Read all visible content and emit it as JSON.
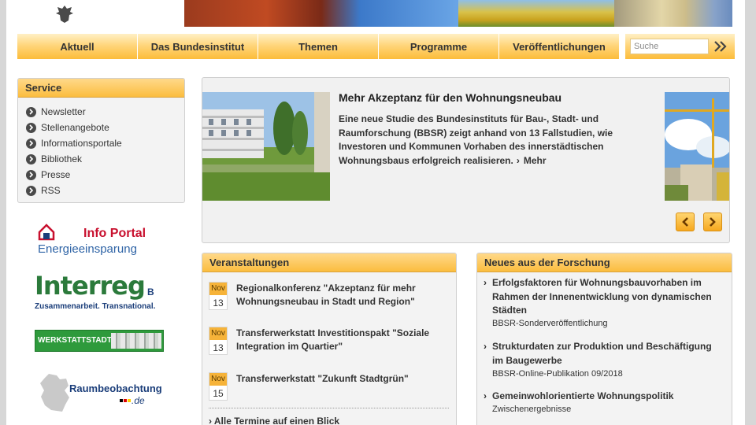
{
  "nav": {
    "items": [
      "Aktuell",
      "Das Bundesinstitut",
      "Themen",
      "Programme",
      "Veröffentlichungen"
    ],
    "search_placeholder": "Suche"
  },
  "service": {
    "title": "Service",
    "items": [
      "Newsletter",
      "Stellenangebote",
      "Informationsportale",
      "Bibliothek",
      "Presse",
      "RSS"
    ]
  },
  "logos": {
    "info_portal": {
      "line1": "Info Portal",
      "line2": "Energieeinsparung"
    },
    "interreg": {
      "name": "Interreg",
      "suffix": "B",
      "tagline": "Zusammenarbeit. Transnational."
    },
    "werkstatt": {
      "name": "WERKSTATTSTADT"
    },
    "raumbeobachtung": {
      "name": "Raumbeobachtung",
      "tld": ".de"
    }
  },
  "slider": {
    "title": "Mehr Akzeptanz für den Wohnungsneubau",
    "text": "Eine neue Studie des Bundesinstituts für Bau-, Stadt- und Raumforschung (BBSR) zeigt anhand von 13 Fallstudien, wie Investoren und Kommunen Vorhaben des innerstädtischen Wohnungsbaus erfolgreich realisieren.",
    "more": "Mehr"
  },
  "events": {
    "title": "Veranstaltungen",
    "items": [
      {
        "month": "Nov",
        "day": "13",
        "title": "Regionalkonferenz \"Akzeptanz für mehr Wohnungsneubau in Stadt und Region\""
      },
      {
        "month": "Nov",
        "day": "13",
        "title": "Transferwerkstatt Investitionspakt \"Soziale Integration im Quartier\""
      },
      {
        "month": "Nov",
        "day": "15",
        "title": "Transferwerkstatt \"Zukunft Stadtgrün\""
      }
    ],
    "all_link": "Alle Termine auf einen Blick"
  },
  "research": {
    "title": "Neues aus der Forschung",
    "items": [
      {
        "title": "Erfolgsfaktoren für Wohnungsbauvorhaben im Rahmen der Innenentwicklung von dynamischen Städten",
        "sub": "BBSR-Sonderveröffentlichung"
      },
      {
        "title": "Strukturdaten zur Produktion und Beschäftigung im Baugewerbe",
        "sub": "BBSR-Online-Publikation 09/2018"
      },
      {
        "title": "Gemeinwohlorientierte Wohnungspolitik",
        "sub": "Zwischenergebnisse"
      }
    ]
  },
  "colors": {
    "accent": "#fbbd3f",
    "accent_light": "#ffeec4",
    "text": "#333333",
    "panel_bg": "#f3f3f3"
  }
}
